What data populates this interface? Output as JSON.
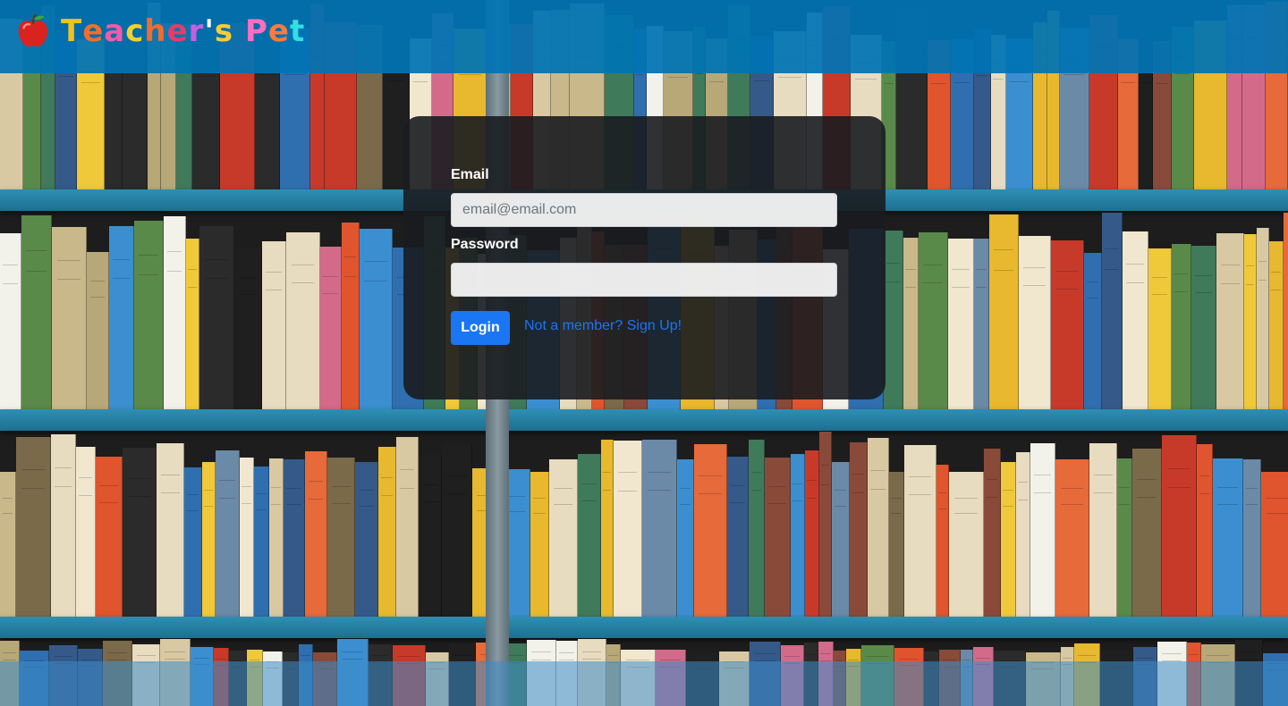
{
  "header": {
    "logo_icon": "apple-icon",
    "brand_letters": [
      {
        "char": "T",
        "color": "#f2c21b"
      },
      {
        "char": "e",
        "color": "#f26c2e"
      },
      {
        "char": "a",
        "color": "#f25aa8"
      },
      {
        "char": "c",
        "color": "#f4d12a"
      },
      {
        "char": "h",
        "color": "#f26c2e"
      },
      {
        "char": "e",
        "color": "#e83b6a"
      },
      {
        "char": "r",
        "color": "#c75ee0"
      },
      {
        "char": "'",
        "color": "#ffffff"
      },
      {
        "char": "s",
        "color": "#ffcc33"
      },
      {
        "char": " ",
        "color": "#ffffff"
      },
      {
        "char": "P",
        "color": "#ff6fbf"
      },
      {
        "char": "e",
        "color": "#ff7a3c"
      },
      {
        "char": "t",
        "color": "#33e0e0"
      }
    ]
  },
  "login": {
    "email_label": "Email",
    "email_placeholder": "email@email.com",
    "email_value": "",
    "password_label": "Password",
    "password_value": "",
    "login_button": "Login",
    "signup_link": "Not a member? Sign Up!"
  },
  "colors": {
    "header_bg": "#0073b4",
    "primary": "#1a76f2",
    "panel_bg": "#191c20"
  }
}
